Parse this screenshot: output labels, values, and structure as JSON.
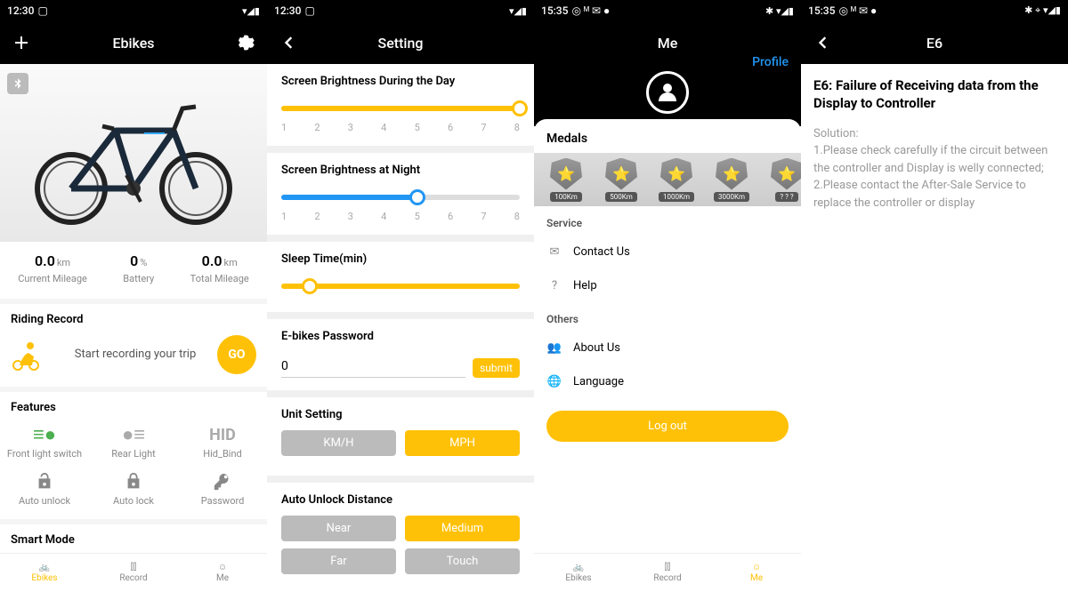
{
  "statusbar": {
    "time_a": "12:30",
    "time_b": "15:35",
    "icons_a": "▢",
    "icons_b": "⬒ M ⬤ ●",
    "right_a": "◣ ▮",
    "right_b": "✱ ◣ ▮",
    "right_c": "✱ ⌖ ◣ ▮"
  },
  "s1": {
    "title": "Ebikes",
    "stats": {
      "cm": {
        "v": "0.0",
        "u": "km",
        "l": "Current Mileage"
      },
      "bat": {
        "v": "0",
        "u": "%",
        "l": "Battery"
      },
      "tm": {
        "v": "0.0",
        "u": "km",
        "l": "Total Mileage"
      }
    },
    "riding": {
      "title": "Riding Record",
      "text": "Start recording your trip",
      "go": "GO"
    },
    "features": {
      "title": "Features",
      "items": [
        "Front light switch",
        "Rear Light",
        "Hid_Bind",
        "Auto unlock",
        "Auto lock",
        "Password"
      ],
      "hid": "HID"
    },
    "smart": "Smart Mode",
    "nav": [
      "Ebikes",
      "Record",
      "Me"
    ]
  },
  "s2": {
    "title": "Setting",
    "day": {
      "title": "Screen Brightness During the Day",
      "val": 8,
      "labels": [
        "1",
        "2",
        "3",
        "4",
        "5",
        "6",
        "7",
        "8"
      ]
    },
    "night": {
      "title": "Screen Brightness at Night",
      "val": 5,
      "labels": [
        "1",
        "2",
        "3",
        "4",
        "5",
        "6",
        "7",
        "8"
      ]
    },
    "sleep": {
      "title": "Sleep Time(min)"
    },
    "pw": {
      "title": "E-bikes Password",
      "value": "0",
      "btn": "submit"
    },
    "unit": {
      "title": "Unit Setting",
      "opts": [
        "KM/H",
        "MPH"
      ]
    },
    "unlock": {
      "title": "Auto Unlock Distance",
      "opts": [
        "Near",
        "Medium",
        "Far",
        "Touch"
      ]
    }
  },
  "s3": {
    "title": "Me",
    "profile": "Profile",
    "medals": {
      "title": "Medals",
      "items": [
        "100Km",
        "500Km",
        "1000Km",
        "3000Km",
        "? ? ?"
      ]
    },
    "service": {
      "title": "Service",
      "items": [
        "Contact Us",
        "Help"
      ]
    },
    "others": {
      "title": "Others",
      "items": [
        "About Us",
        "Language"
      ]
    },
    "logout": "Log out",
    "nav": [
      "Ebikes",
      "Record",
      "Me"
    ]
  },
  "s4": {
    "title": "E6",
    "heading": "E6: Failure of Receiving data from the Display to Controller",
    "solution_label": "Solution:",
    "l1": "1.Please check carefully if the circuit between the controller and Display is welly connected;",
    "l2": "2.Please contact the After-Sale Service to replace the controller or display"
  }
}
